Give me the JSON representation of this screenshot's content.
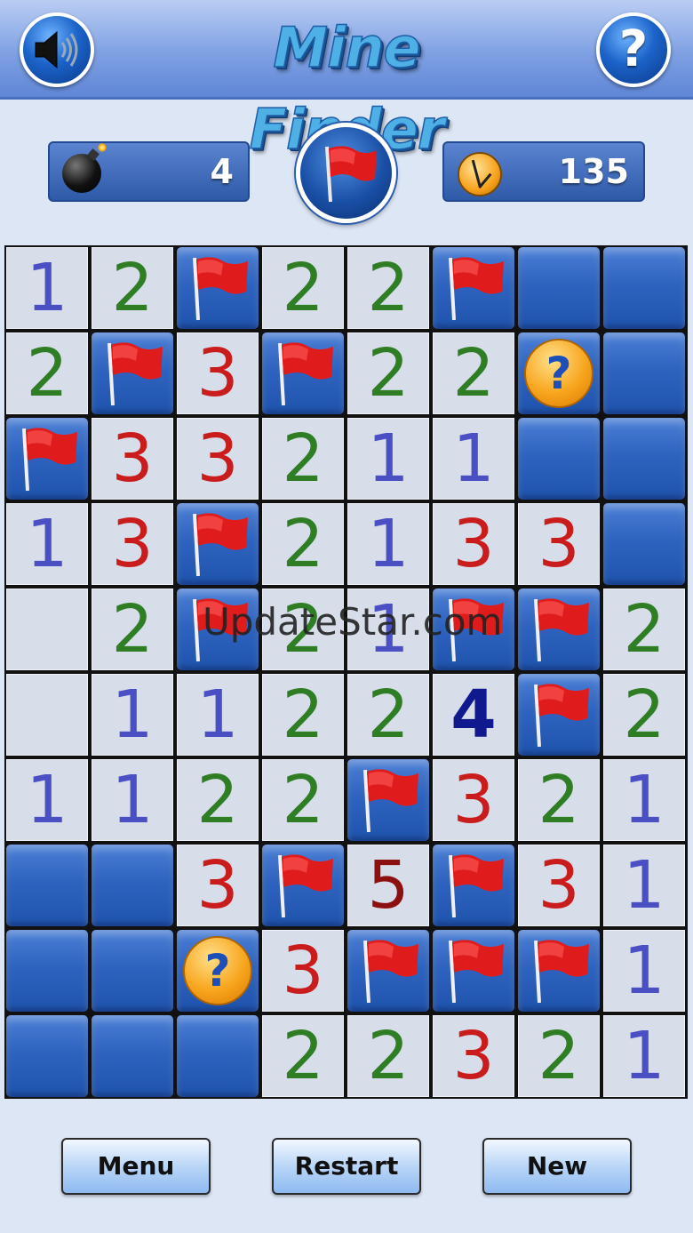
{
  "header": {
    "title": "Mine Finder",
    "sound_icon": "speaker-icon",
    "help_label": "?"
  },
  "status": {
    "mines_remaining": "4",
    "time_elapsed": "135",
    "mode": "flag-mode"
  },
  "board": {
    "columns": 8,
    "rows": 10,
    "cells": [
      [
        "1",
        "2",
        "F",
        "2",
        "2",
        "F",
        "C",
        "C"
      ],
      [
        "2",
        "F",
        "3",
        "F",
        "2",
        "2",
        "Q",
        "C"
      ],
      [
        "F",
        "3",
        "3",
        "2",
        "1",
        "1",
        "C",
        "C"
      ],
      [
        "1",
        "3",
        "F",
        "2",
        "1",
        "3",
        "3",
        "C"
      ],
      [
        "",
        "2",
        "F",
        "2",
        "1",
        "F",
        "F",
        "2"
      ],
      [
        "",
        "1",
        "1",
        "2",
        "2",
        "4",
        "F",
        "2"
      ],
      [
        "1",
        "1",
        "2",
        "2",
        "F",
        "3",
        "2",
        "1"
      ],
      [
        "C",
        "C",
        "3",
        "F",
        "5",
        "F",
        "3",
        "1"
      ],
      [
        "C",
        "C",
        "Q",
        "3",
        "F",
        "F",
        "F",
        "1"
      ],
      [
        "C",
        "C",
        "C",
        "2",
        "2",
        "3",
        "2",
        "1"
      ]
    ]
  },
  "watermark": "UpdateStar.com",
  "footer": {
    "menu_label": "Menu",
    "restart_label": "Restart",
    "new_label": "New"
  },
  "colors": {
    "flag": "#e01b1b",
    "covered_tile": "#2e63bf",
    "open_tile": "#d7dde9"
  }
}
